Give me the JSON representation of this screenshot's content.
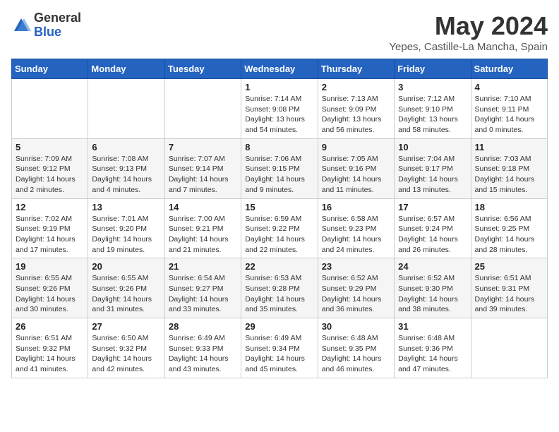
{
  "header": {
    "logo_general": "General",
    "logo_blue": "Blue",
    "month_title": "May 2024",
    "location": "Yepes, Castille-La Mancha, Spain"
  },
  "weekdays": [
    "Sunday",
    "Monday",
    "Tuesday",
    "Wednesday",
    "Thursday",
    "Friday",
    "Saturday"
  ],
  "weeks": [
    [
      {
        "day": "",
        "sunrise": "",
        "sunset": "",
        "daylight": ""
      },
      {
        "day": "",
        "sunrise": "",
        "sunset": "",
        "daylight": ""
      },
      {
        "day": "",
        "sunrise": "",
        "sunset": "",
        "daylight": ""
      },
      {
        "day": "1",
        "sunrise": "Sunrise: 7:14 AM",
        "sunset": "Sunset: 9:08 PM",
        "daylight": "Daylight: 13 hours and 54 minutes."
      },
      {
        "day": "2",
        "sunrise": "Sunrise: 7:13 AM",
        "sunset": "Sunset: 9:09 PM",
        "daylight": "Daylight: 13 hours and 56 minutes."
      },
      {
        "day": "3",
        "sunrise": "Sunrise: 7:12 AM",
        "sunset": "Sunset: 9:10 PM",
        "daylight": "Daylight: 13 hours and 58 minutes."
      },
      {
        "day": "4",
        "sunrise": "Sunrise: 7:10 AM",
        "sunset": "Sunset: 9:11 PM",
        "daylight": "Daylight: 14 hours and 0 minutes."
      }
    ],
    [
      {
        "day": "5",
        "sunrise": "Sunrise: 7:09 AM",
        "sunset": "Sunset: 9:12 PM",
        "daylight": "Daylight: 14 hours and 2 minutes."
      },
      {
        "day": "6",
        "sunrise": "Sunrise: 7:08 AM",
        "sunset": "Sunset: 9:13 PM",
        "daylight": "Daylight: 14 hours and 4 minutes."
      },
      {
        "day": "7",
        "sunrise": "Sunrise: 7:07 AM",
        "sunset": "Sunset: 9:14 PM",
        "daylight": "Daylight: 14 hours and 7 minutes."
      },
      {
        "day": "8",
        "sunrise": "Sunrise: 7:06 AM",
        "sunset": "Sunset: 9:15 PM",
        "daylight": "Daylight: 14 hours and 9 minutes."
      },
      {
        "day": "9",
        "sunrise": "Sunrise: 7:05 AM",
        "sunset": "Sunset: 9:16 PM",
        "daylight": "Daylight: 14 hours and 11 minutes."
      },
      {
        "day": "10",
        "sunrise": "Sunrise: 7:04 AM",
        "sunset": "Sunset: 9:17 PM",
        "daylight": "Daylight: 14 hours and 13 minutes."
      },
      {
        "day": "11",
        "sunrise": "Sunrise: 7:03 AM",
        "sunset": "Sunset: 9:18 PM",
        "daylight": "Daylight: 14 hours and 15 minutes."
      }
    ],
    [
      {
        "day": "12",
        "sunrise": "Sunrise: 7:02 AM",
        "sunset": "Sunset: 9:19 PM",
        "daylight": "Daylight: 14 hours and 17 minutes."
      },
      {
        "day": "13",
        "sunrise": "Sunrise: 7:01 AM",
        "sunset": "Sunset: 9:20 PM",
        "daylight": "Daylight: 14 hours and 19 minutes."
      },
      {
        "day": "14",
        "sunrise": "Sunrise: 7:00 AM",
        "sunset": "Sunset: 9:21 PM",
        "daylight": "Daylight: 14 hours and 21 minutes."
      },
      {
        "day": "15",
        "sunrise": "Sunrise: 6:59 AM",
        "sunset": "Sunset: 9:22 PM",
        "daylight": "Daylight: 14 hours and 22 minutes."
      },
      {
        "day": "16",
        "sunrise": "Sunrise: 6:58 AM",
        "sunset": "Sunset: 9:23 PM",
        "daylight": "Daylight: 14 hours and 24 minutes."
      },
      {
        "day": "17",
        "sunrise": "Sunrise: 6:57 AM",
        "sunset": "Sunset: 9:24 PM",
        "daylight": "Daylight: 14 hours and 26 minutes."
      },
      {
        "day": "18",
        "sunrise": "Sunrise: 6:56 AM",
        "sunset": "Sunset: 9:25 PM",
        "daylight": "Daylight: 14 hours and 28 minutes."
      }
    ],
    [
      {
        "day": "19",
        "sunrise": "Sunrise: 6:55 AM",
        "sunset": "Sunset: 9:26 PM",
        "daylight": "Daylight: 14 hours and 30 minutes."
      },
      {
        "day": "20",
        "sunrise": "Sunrise: 6:55 AM",
        "sunset": "Sunset: 9:26 PM",
        "daylight": "Daylight: 14 hours and 31 minutes."
      },
      {
        "day": "21",
        "sunrise": "Sunrise: 6:54 AM",
        "sunset": "Sunset: 9:27 PM",
        "daylight": "Daylight: 14 hours and 33 minutes."
      },
      {
        "day": "22",
        "sunrise": "Sunrise: 6:53 AM",
        "sunset": "Sunset: 9:28 PM",
        "daylight": "Daylight: 14 hours and 35 minutes."
      },
      {
        "day": "23",
        "sunrise": "Sunrise: 6:52 AM",
        "sunset": "Sunset: 9:29 PM",
        "daylight": "Daylight: 14 hours and 36 minutes."
      },
      {
        "day": "24",
        "sunrise": "Sunrise: 6:52 AM",
        "sunset": "Sunset: 9:30 PM",
        "daylight": "Daylight: 14 hours and 38 minutes."
      },
      {
        "day": "25",
        "sunrise": "Sunrise: 6:51 AM",
        "sunset": "Sunset: 9:31 PM",
        "daylight": "Daylight: 14 hours and 39 minutes."
      }
    ],
    [
      {
        "day": "26",
        "sunrise": "Sunrise: 6:51 AM",
        "sunset": "Sunset: 9:32 PM",
        "daylight": "Daylight: 14 hours and 41 minutes."
      },
      {
        "day": "27",
        "sunrise": "Sunrise: 6:50 AM",
        "sunset": "Sunset: 9:32 PM",
        "daylight": "Daylight: 14 hours and 42 minutes."
      },
      {
        "day": "28",
        "sunrise": "Sunrise: 6:49 AM",
        "sunset": "Sunset: 9:33 PM",
        "daylight": "Daylight: 14 hours and 43 minutes."
      },
      {
        "day": "29",
        "sunrise": "Sunrise: 6:49 AM",
        "sunset": "Sunset: 9:34 PM",
        "daylight": "Daylight: 14 hours and 45 minutes."
      },
      {
        "day": "30",
        "sunrise": "Sunrise: 6:48 AM",
        "sunset": "Sunset: 9:35 PM",
        "daylight": "Daylight: 14 hours and 46 minutes."
      },
      {
        "day": "31",
        "sunrise": "Sunrise: 6:48 AM",
        "sunset": "Sunset: 9:36 PM",
        "daylight": "Daylight: 14 hours and 47 minutes."
      },
      {
        "day": "",
        "sunrise": "",
        "sunset": "",
        "daylight": ""
      }
    ]
  ]
}
